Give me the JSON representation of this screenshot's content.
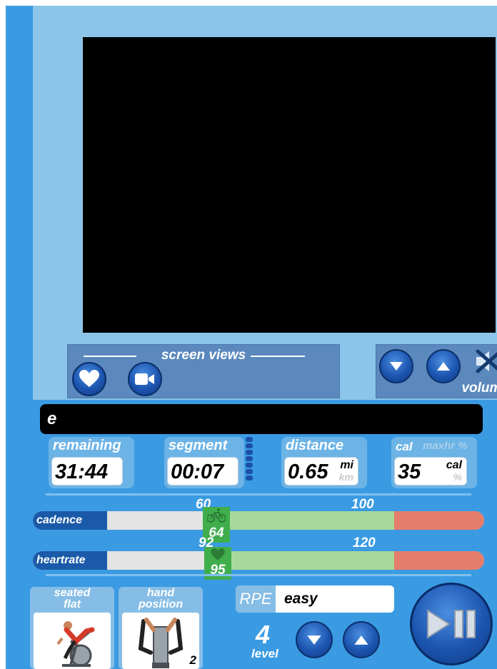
{
  "screen_views": {
    "label": "screen views",
    "buttons": [
      {
        "icon": "heart-icon"
      },
      {
        "icon": "camera-icon"
      }
    ]
  },
  "volume": {
    "label": "volume",
    "down_icon": "triangle-down-icon",
    "up_icon": "triangle-up-icon",
    "mute_icon": "mute-icon"
  },
  "message": "e",
  "stats": {
    "remaining": {
      "label": "remaining",
      "value": "31:44"
    },
    "segment": {
      "label": "segment",
      "value": "00:07"
    },
    "distance": {
      "label": "distance",
      "value": "0.65",
      "unit_primary": "mi",
      "unit_secondary": "km"
    },
    "calories": {
      "label": "cal",
      "label_alt": "maxhr %",
      "value": "35",
      "unit_primary": "cal",
      "unit_secondary": "%"
    }
  },
  "cadence": {
    "label": "cadence",
    "low": "60",
    "high": "100",
    "current": "64",
    "icon": "bike-icon"
  },
  "heartrate": {
    "label": "heartrate",
    "low": "92",
    "high": "120",
    "current": "95",
    "icon": "heart-icon"
  },
  "position_tiles": [
    {
      "label_line1": "seated",
      "label_line2": "flat",
      "badge": ""
    },
    {
      "label_line1": "hand",
      "label_line2": "position",
      "badge": "2"
    }
  ],
  "rpe": {
    "label": "RPE",
    "value": "easy"
  },
  "level": {
    "value": "4",
    "label": "level"
  },
  "colors": {
    "background": "#3a9be3",
    "panel": "#8cc5e9",
    "button_blue": "#1c55b0",
    "zone_green": "#a9d99a",
    "zone_red": "#e57d6c",
    "marker_green": "#3fae4b"
  }
}
